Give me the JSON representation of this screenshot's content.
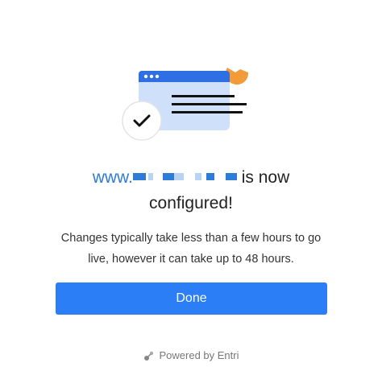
{
  "headline": {
    "domain_prefix": "www.",
    "suffix": " is now",
    "line2": "configured!"
  },
  "description": {
    "line1": "Changes typically take less than a few hours to go",
    "line2": "live, however it can take up to 48 hours."
  },
  "done_button": {
    "label": "Done"
  },
  "footer": {
    "powered_by": "Powered by Entri"
  },
  "colors": {
    "accent": "#2b7ef6",
    "domain_text": "#2f7bd8",
    "illustration_window": "#cfe0fb",
    "illustration_bar": "#2f6fe4",
    "illustration_accent": "#f29b38"
  },
  "icons": {
    "illustration": "browser-window-checkmark-illustration",
    "footer_logo": "entri-logo-icon"
  }
}
